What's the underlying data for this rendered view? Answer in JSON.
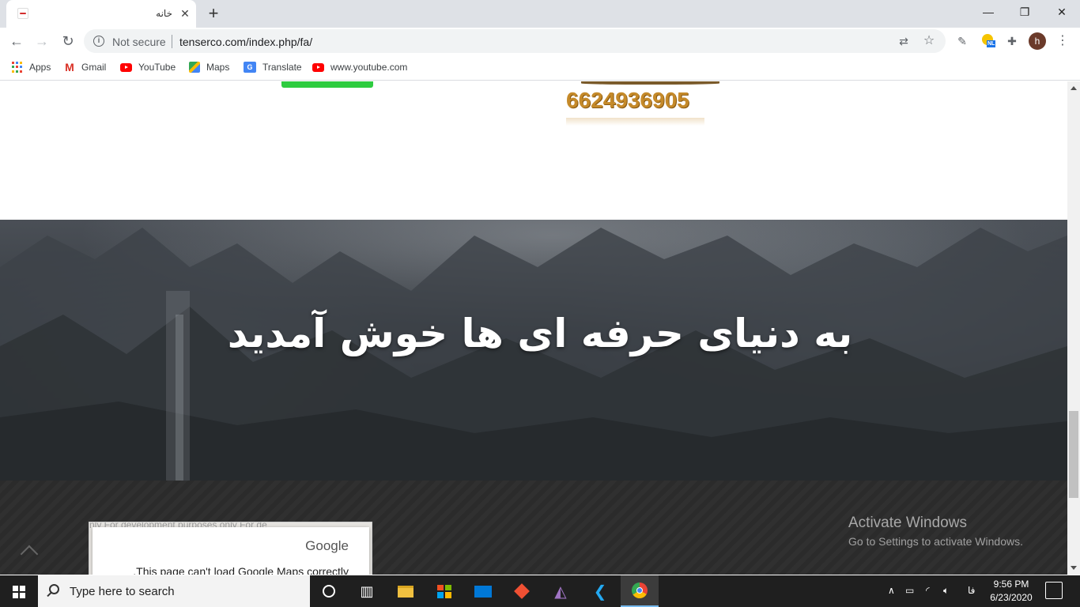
{
  "browser": {
    "tab": {
      "title": "خانه",
      "close": "✕"
    },
    "new_tab": "+",
    "window_controls": {
      "minimize": "—",
      "restore": "❐",
      "close": "✕"
    },
    "nav": {
      "back": "←",
      "forward": "→",
      "reload": "↻"
    },
    "omnibox": {
      "security": "Not secure",
      "url": "tenserco.com/index.php/fa/"
    },
    "profile_initial": "h",
    "menu": "⋮",
    "ext_badge": "NL"
  },
  "bookmarks": [
    {
      "label": "Apps",
      "icon": "apps-grid-icon"
    },
    {
      "label": "Gmail",
      "icon": "gmail-icon"
    },
    {
      "label": "YouTube",
      "icon": "youtube-icon"
    },
    {
      "label": "Maps",
      "icon": "maps-icon"
    },
    {
      "label": "Translate",
      "icon": "translate-icon"
    },
    {
      "label": "www.youtube.com",
      "icon": "youtube-icon"
    }
  ],
  "page": {
    "phone": "6624936905",
    "hero_title": "به دنیای حرفه ای ها خوش آمدید",
    "map": {
      "watermark": "nly       For development purposes only        For de",
      "brand": "Google",
      "message": ".This page can't load Google Maps correctly"
    }
  },
  "activation": {
    "title": "Activate Windows",
    "subtitle": "Go to Settings to activate Windows."
  },
  "taskbar": {
    "search_placeholder": "Type here to search",
    "lang": "فا",
    "time": "9:56 PM",
    "date": "6/23/2020"
  },
  "colors": {
    "accent_green": "#2ecc40",
    "phone_gold": "#c58a2a",
    "taskbar": "#1f1f1f"
  }
}
